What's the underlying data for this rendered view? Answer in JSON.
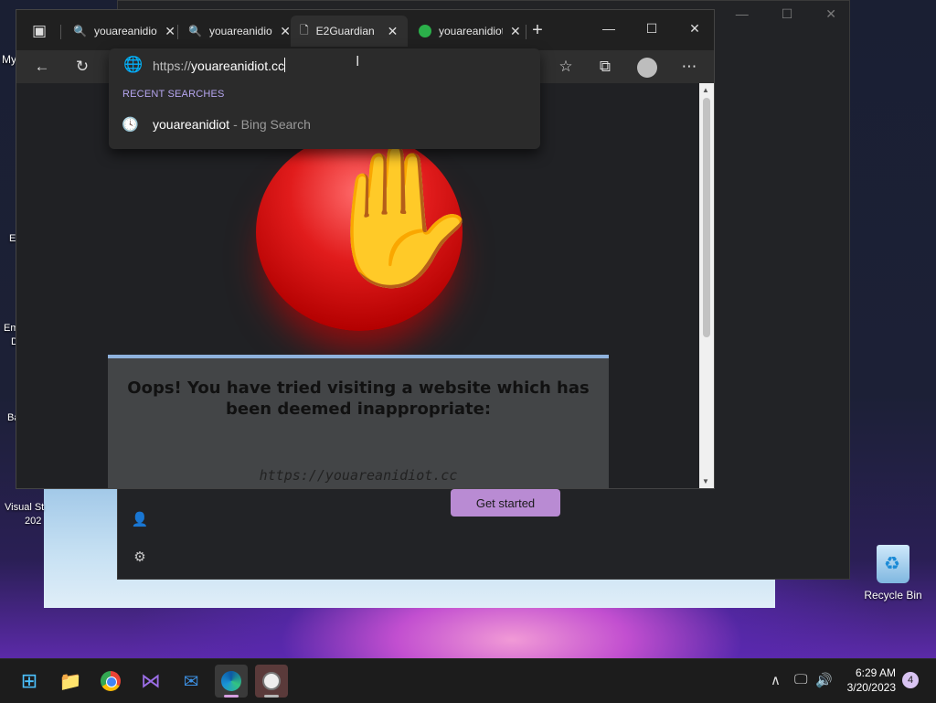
{
  "desktop": {
    "icons": [
      {
        "label": "My"
      },
      {
        "label": "E"
      },
      {
        "label": "Em"
      },
      {
        "label": "D"
      },
      {
        "label": "Ba"
      },
      {
        "label": "Visual St"
      },
      {
        "label": "202"
      }
    ],
    "recycle_bin_label": "Recycle Bin"
  },
  "background_app": {
    "button_label": "Get started"
  },
  "browser": {
    "tabs": [
      {
        "title": "youareanidiot",
        "icon": "search-icon",
        "active": false
      },
      {
        "title": "youareanidiot",
        "icon": "search-icon",
        "active": false
      },
      {
        "title": "E2Guardian",
        "icon": "document-icon",
        "active": true
      },
      {
        "title": "youareanidiot",
        "icon": "site-favicon-icon",
        "active": false
      }
    ],
    "address": {
      "protocol": "https://",
      "host": "youareanidiot.cc"
    },
    "dropdown": {
      "section_heading": "RECENT SEARCHES",
      "suggestions": [
        {
          "query": "youareanidiot",
          "source": "- Bing Search"
        }
      ]
    },
    "page": {
      "message": "Oops! You have tried visiting a website which has been deemed inappropriate:",
      "blocked_url": "https://youareanidiot.cc"
    }
  },
  "taskbar": {
    "apps": [
      "start",
      "file-explorer",
      "chrome",
      "visual-studio",
      "mail",
      "edge",
      "clock-app"
    ],
    "time": "6:29 AM",
    "date": "3/20/2023",
    "notification_count": "4"
  },
  "colors": {
    "accent_purple": "#b98bd3",
    "dropdown_heading": "#b6a6f0",
    "stop_red": "#e11c1c"
  }
}
